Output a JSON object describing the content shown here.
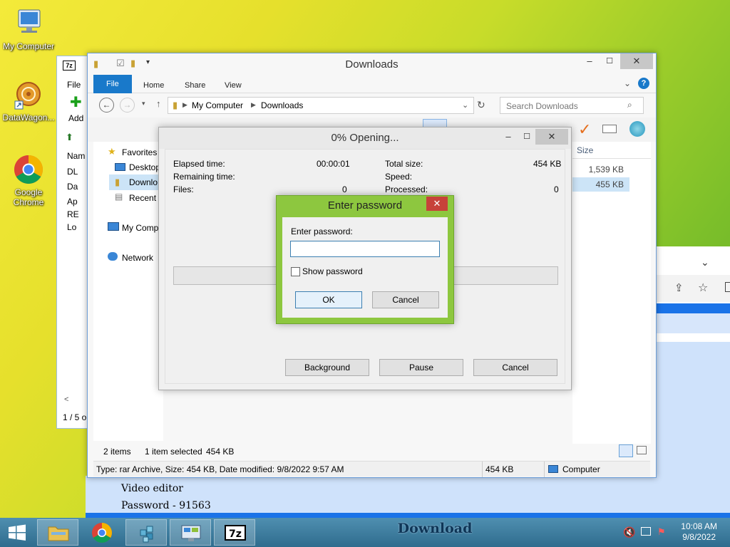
{
  "desktop": {
    "icons": [
      {
        "label": "My Computer"
      },
      {
        "label": "DataWagon..."
      },
      {
        "label": "Google Chrome"
      }
    ]
  },
  "browser": {
    "page_text_1": "Video editor",
    "page_text_2": "Password - 91563"
  },
  "sevenzip_back": {
    "app_icon": "7z",
    "menu_file": "File",
    "add_label": "Add",
    "col_name": "Nam",
    "rows": [
      "DL",
      "Da",
      "Ap",
      "RE",
      "Lo"
    ],
    "status": "1 / 5 o"
  },
  "explorer": {
    "title": "Downloads",
    "tabs": [
      "File",
      "Home",
      "Share",
      "View"
    ],
    "breadcrumb": [
      "My Computer",
      "Downloads"
    ],
    "search_placeholder": "Search Downloads",
    "nav": {
      "favorites": "Favorites",
      "desktop": "Desktop",
      "downloads": "Downlo",
      "recent": "Recent p",
      "my_computer": "My Comp",
      "network": "Network"
    },
    "column_size": "Size",
    "sizes": [
      "1,539 KB",
      "455 KB"
    ],
    "status_items": "2 items",
    "status_selected": "1 item selected",
    "status_selected_size": "454 KB",
    "details_text": "Type: rar Archive, Size: 454 KB, Date modified: 9/8/2022 9:57 AM",
    "details_size": "454 KB",
    "details_location": "Computer"
  },
  "progress": {
    "title": "0% Opening...",
    "elapsed_label": "Elapsed time:",
    "elapsed_value": "00:00:01",
    "remaining_label": "Remaining time:",
    "files_label": "Files:",
    "files_value": "0",
    "total_size_label": "Total size:",
    "total_size_value": "454 KB",
    "speed_label": "Speed:",
    "processed_label": "Processed:",
    "processed_value": "0",
    "background_btn": "Background",
    "pause_btn": "Pause",
    "cancel_btn": "Cancel"
  },
  "password_dialog": {
    "title": "Enter password",
    "prompt": "Enter password:",
    "value": "",
    "show_password": "Show password",
    "show_password_checked": false,
    "ok": "OK",
    "cancel": "Cancel"
  },
  "taskbar": {
    "banner": "Download",
    "time": "10:08 AM",
    "date": "9/8/2022"
  },
  "colors": {
    "accent_green": "#8dc73f",
    "ribbon_file": "#1979ca",
    "taskbar": "#3b7a9c"
  }
}
